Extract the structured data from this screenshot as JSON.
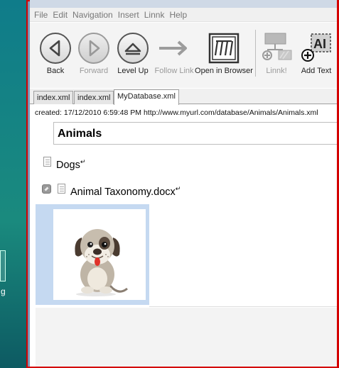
{
  "menu": [
    "File",
    "Edit",
    "Navigation",
    "Insert",
    "Linnk",
    "Help"
  ],
  "toolbar": {
    "back": {
      "label": "Back",
      "icon": "back-arrow-icon",
      "enabled": true
    },
    "forward": {
      "label": "Forward",
      "icon": "forward-arrow-icon",
      "enabled": false
    },
    "levelup": {
      "label": "Level Up",
      "icon": "level-up-icon",
      "enabled": true
    },
    "followlink": {
      "label": "Follow Link",
      "icon": "follow-link-arrow-icon",
      "enabled": false
    },
    "openbrowser": {
      "label": "Open in Browser",
      "icon": "browser-icon",
      "enabled": true
    },
    "linnk": {
      "label": "Linnk!",
      "icon": "linnk-icon",
      "enabled": false
    },
    "addtext": {
      "label": "Add Text",
      "icon": "add-text-icon",
      "enabled": true
    }
  },
  "tabs": [
    {
      "label": "index.xml",
      "active": false
    },
    {
      "label": "index.xml",
      "active": false
    },
    {
      "label": "MyDatabase.xml",
      "active": true
    }
  ],
  "content": {
    "created": "created: 17/12/2010 6:59:48 PM http://www.myurl.com/database/Animals/Animals.xml",
    "title": "Animals",
    "entries": [
      {
        "text": "Dogs",
        "icon": "document-icon"
      },
      {
        "text": "Animal Taxonomy.docx",
        "icon": "document-icon",
        "attachment": true
      }
    ],
    "image": "dog-cartoon-image"
  },
  "colors": {
    "window_border": "#d40000",
    "selection": "#c5d9f1"
  }
}
